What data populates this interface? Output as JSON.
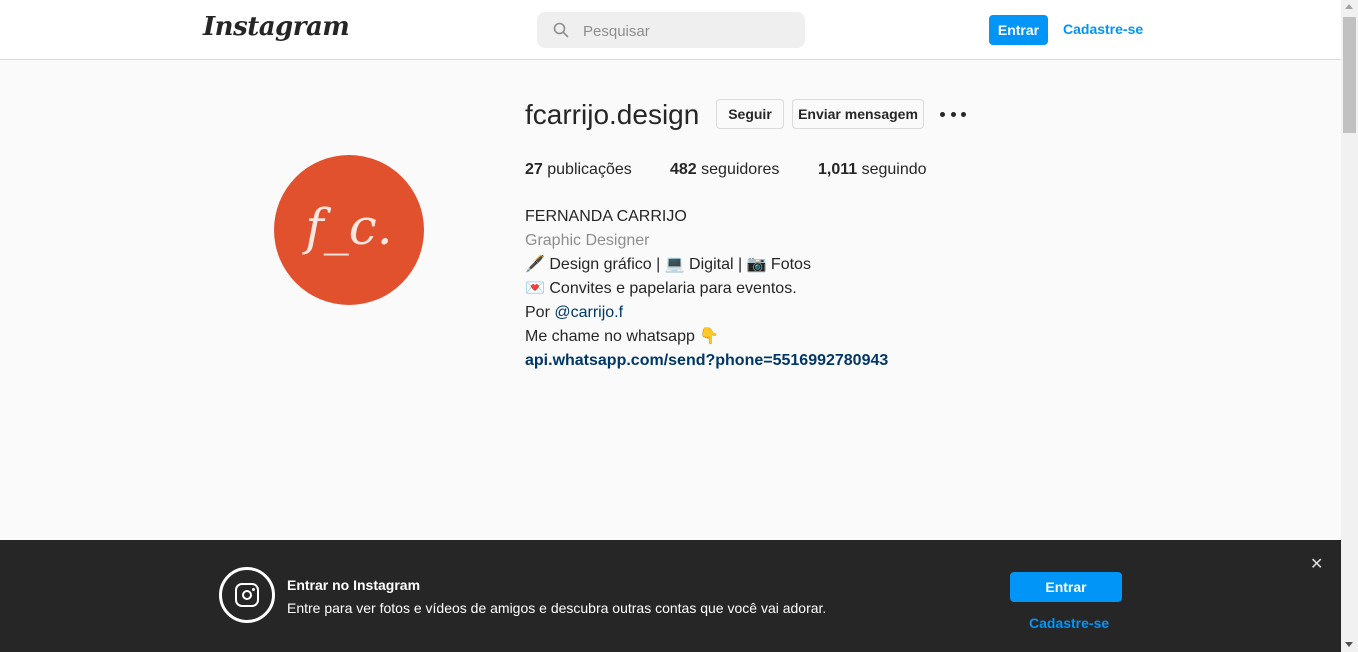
{
  "header": {
    "logo": "Instagram",
    "search_placeholder": "Pesquisar",
    "login_label": "Entrar",
    "signup_label": "Cadastre-se"
  },
  "profile": {
    "avatar_text": "f_c.",
    "username": "fcarrijo.design",
    "follow_label": "Seguir",
    "message_label": "Enviar mensagem",
    "stats": {
      "posts_count": "27",
      "posts_label": " publicações",
      "followers_count": "482",
      "followers_label": " seguidores",
      "following_count": "1,011",
      "following_label": " seguindo"
    },
    "bio": {
      "full_name": "FERNANDA CARRIJO",
      "category": "Graphic Designer",
      "line1": "🖋️ Design gráfico | 💻 Digital | 📷 Fotos",
      "line2": "💌 Convites e papelaria para eventos.",
      "line3_prefix": "Por ",
      "line3_mention": "@carrijo.f",
      "line4": "Me chame no whatsapp 👇",
      "link": "api.whatsapp.com/send?phone=5516992780943"
    }
  },
  "banner": {
    "title": "Entrar no Instagram",
    "text": "Entre para ver fotos e vídeos de amigos e descubra outras contas que você vai adorar.",
    "login_label": "Entrar",
    "signup_label": "Cadastre-se",
    "close_label": "✕"
  },
  "colors": {
    "accent": "#0095f6",
    "avatar_bg": "#e2512d",
    "banner_bg": "#262626",
    "link": "#00376b"
  }
}
